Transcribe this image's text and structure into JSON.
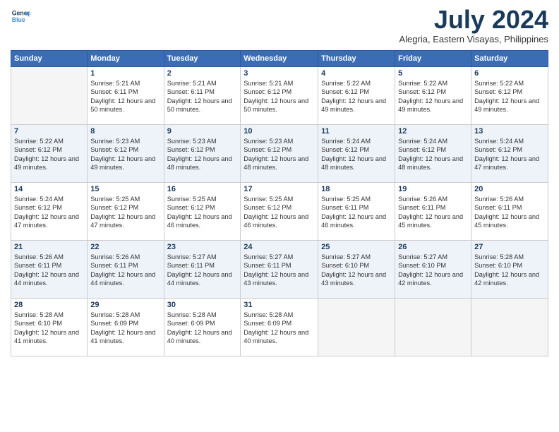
{
  "header": {
    "logo_line1": "General",
    "logo_line2": "Blue",
    "month_year": "July 2024",
    "location": "Alegria, Eastern Visayas, Philippines"
  },
  "weekdays": [
    "Sunday",
    "Monday",
    "Tuesday",
    "Wednesday",
    "Thursday",
    "Friday",
    "Saturday"
  ],
  "weeks": [
    [
      {
        "day": "",
        "sunrise": "",
        "sunset": "",
        "daylight": ""
      },
      {
        "day": "1",
        "sunrise": "Sunrise: 5:21 AM",
        "sunset": "Sunset: 6:11 PM",
        "daylight": "Daylight: 12 hours and 50 minutes."
      },
      {
        "day": "2",
        "sunrise": "Sunrise: 5:21 AM",
        "sunset": "Sunset: 6:11 PM",
        "daylight": "Daylight: 12 hours and 50 minutes."
      },
      {
        "day": "3",
        "sunrise": "Sunrise: 5:21 AM",
        "sunset": "Sunset: 6:12 PM",
        "daylight": "Daylight: 12 hours and 50 minutes."
      },
      {
        "day": "4",
        "sunrise": "Sunrise: 5:22 AM",
        "sunset": "Sunset: 6:12 PM",
        "daylight": "Daylight: 12 hours and 49 minutes."
      },
      {
        "day": "5",
        "sunrise": "Sunrise: 5:22 AM",
        "sunset": "Sunset: 6:12 PM",
        "daylight": "Daylight: 12 hours and 49 minutes."
      },
      {
        "day": "6",
        "sunrise": "Sunrise: 5:22 AM",
        "sunset": "Sunset: 6:12 PM",
        "daylight": "Daylight: 12 hours and 49 minutes."
      }
    ],
    [
      {
        "day": "7",
        "sunrise": "Sunrise: 5:22 AM",
        "sunset": "Sunset: 6:12 PM",
        "daylight": "Daylight: 12 hours and 49 minutes."
      },
      {
        "day": "8",
        "sunrise": "Sunrise: 5:23 AM",
        "sunset": "Sunset: 6:12 PM",
        "daylight": "Daylight: 12 hours and 49 minutes."
      },
      {
        "day": "9",
        "sunrise": "Sunrise: 5:23 AM",
        "sunset": "Sunset: 6:12 PM",
        "daylight": "Daylight: 12 hours and 48 minutes."
      },
      {
        "day": "10",
        "sunrise": "Sunrise: 5:23 AM",
        "sunset": "Sunset: 6:12 PM",
        "daylight": "Daylight: 12 hours and 48 minutes."
      },
      {
        "day": "11",
        "sunrise": "Sunrise: 5:24 AM",
        "sunset": "Sunset: 6:12 PM",
        "daylight": "Daylight: 12 hours and 48 minutes."
      },
      {
        "day": "12",
        "sunrise": "Sunrise: 5:24 AM",
        "sunset": "Sunset: 6:12 PM",
        "daylight": "Daylight: 12 hours and 48 minutes."
      },
      {
        "day": "13",
        "sunrise": "Sunrise: 5:24 AM",
        "sunset": "Sunset: 6:12 PM",
        "daylight": "Daylight: 12 hours and 47 minutes."
      }
    ],
    [
      {
        "day": "14",
        "sunrise": "Sunrise: 5:24 AM",
        "sunset": "Sunset: 6:12 PM",
        "daylight": "Daylight: 12 hours and 47 minutes."
      },
      {
        "day": "15",
        "sunrise": "Sunrise: 5:25 AM",
        "sunset": "Sunset: 6:12 PM",
        "daylight": "Daylight: 12 hours and 47 minutes."
      },
      {
        "day": "16",
        "sunrise": "Sunrise: 5:25 AM",
        "sunset": "Sunset: 6:12 PM",
        "daylight": "Daylight: 12 hours and 46 minutes."
      },
      {
        "day": "17",
        "sunrise": "Sunrise: 5:25 AM",
        "sunset": "Sunset: 6:12 PM",
        "daylight": "Daylight: 12 hours and 46 minutes."
      },
      {
        "day": "18",
        "sunrise": "Sunrise: 5:25 AM",
        "sunset": "Sunset: 6:11 PM",
        "daylight": "Daylight: 12 hours and 46 minutes."
      },
      {
        "day": "19",
        "sunrise": "Sunrise: 5:26 AM",
        "sunset": "Sunset: 6:11 PM",
        "daylight": "Daylight: 12 hours and 45 minutes."
      },
      {
        "day": "20",
        "sunrise": "Sunrise: 5:26 AM",
        "sunset": "Sunset: 6:11 PM",
        "daylight": "Daylight: 12 hours and 45 minutes."
      }
    ],
    [
      {
        "day": "21",
        "sunrise": "Sunrise: 5:26 AM",
        "sunset": "Sunset: 6:11 PM",
        "daylight": "Daylight: 12 hours and 44 minutes."
      },
      {
        "day": "22",
        "sunrise": "Sunrise: 5:26 AM",
        "sunset": "Sunset: 6:11 PM",
        "daylight": "Daylight: 12 hours and 44 minutes."
      },
      {
        "day": "23",
        "sunrise": "Sunrise: 5:27 AM",
        "sunset": "Sunset: 6:11 PM",
        "daylight": "Daylight: 12 hours and 44 minutes."
      },
      {
        "day": "24",
        "sunrise": "Sunrise: 5:27 AM",
        "sunset": "Sunset: 6:11 PM",
        "daylight": "Daylight: 12 hours and 43 minutes."
      },
      {
        "day": "25",
        "sunrise": "Sunrise: 5:27 AM",
        "sunset": "Sunset: 6:10 PM",
        "daylight": "Daylight: 12 hours and 43 minutes."
      },
      {
        "day": "26",
        "sunrise": "Sunrise: 5:27 AM",
        "sunset": "Sunset: 6:10 PM",
        "daylight": "Daylight: 12 hours and 42 minutes."
      },
      {
        "day": "27",
        "sunrise": "Sunrise: 5:28 AM",
        "sunset": "Sunset: 6:10 PM",
        "daylight": "Daylight: 12 hours and 42 minutes."
      }
    ],
    [
      {
        "day": "28",
        "sunrise": "Sunrise: 5:28 AM",
        "sunset": "Sunset: 6:10 PM",
        "daylight": "Daylight: 12 hours and 41 minutes."
      },
      {
        "day": "29",
        "sunrise": "Sunrise: 5:28 AM",
        "sunset": "Sunset: 6:09 PM",
        "daylight": "Daylight: 12 hours and 41 minutes."
      },
      {
        "day": "30",
        "sunrise": "Sunrise: 5:28 AM",
        "sunset": "Sunset: 6:09 PM",
        "daylight": "Daylight: 12 hours and 40 minutes."
      },
      {
        "day": "31",
        "sunrise": "Sunrise: 5:28 AM",
        "sunset": "Sunset: 6:09 PM",
        "daylight": "Daylight: 12 hours and 40 minutes."
      },
      {
        "day": "",
        "sunrise": "",
        "sunset": "",
        "daylight": ""
      },
      {
        "day": "",
        "sunrise": "",
        "sunset": "",
        "daylight": ""
      },
      {
        "day": "",
        "sunrise": "",
        "sunset": "",
        "daylight": ""
      }
    ]
  ]
}
